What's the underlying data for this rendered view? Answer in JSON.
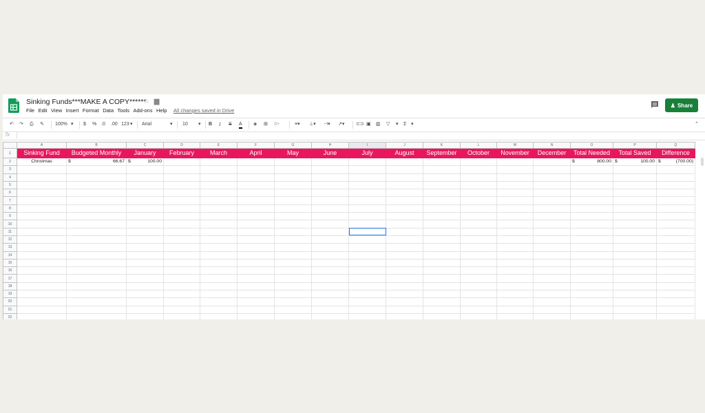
{
  "doc": {
    "title": "Sinking Funds***MAKE A COPY******",
    "saved_status": "All changes saved in Drive"
  },
  "menu": [
    "File",
    "Edit",
    "View",
    "Insert",
    "Format",
    "Data",
    "Tools",
    "Add-ons",
    "Help"
  ],
  "share_label": "Share",
  "toolbar": {
    "zoom": "100%",
    "currency": "$",
    "percent": "%",
    "dec_less": ".0",
    "dec_more": ".00",
    "format_more": "123",
    "font": "Arial",
    "font_size": "10",
    "sum": "Σ"
  },
  "formula_bar": {
    "fx_label": "fx"
  },
  "brand": {
    "green": "#188038",
    "header_pink": "#e8175d",
    "select_blue": "#1a73e8"
  },
  "sheet": {
    "columns": [
      "A",
      "B",
      "C",
      "D",
      "E",
      "F",
      "G",
      "H",
      "I",
      "J",
      "K",
      "L",
      "M",
      "N",
      "O",
      "P",
      "Q"
    ],
    "header_row": [
      "Sinking Fund",
      "Budgeted Monthly",
      "January",
      "February",
      "March",
      "April",
      "May",
      "June",
      "July",
      "August",
      "September",
      "October",
      "November",
      "December",
      "Total Needed",
      "Total Saved",
      "Difference"
    ],
    "row2": {
      "name": "Christmas",
      "budgeted_currency": "$",
      "budgeted": "66.67",
      "jan_currency": "$",
      "jan": "100.00",
      "total_needed_currency": "$",
      "total_needed": "800.00",
      "total_saved_currency": "$",
      "total_saved": "100.00",
      "difference_currency": "$",
      "difference": "(700.00)"
    },
    "row_numbers": [
      "1",
      "2",
      "3",
      "4",
      "5",
      "6",
      "7",
      "8",
      "9",
      "10",
      "11",
      "12",
      "13",
      "14",
      "15",
      "16",
      "17",
      "18",
      "19",
      "20",
      "21",
      "22"
    ]
  }
}
